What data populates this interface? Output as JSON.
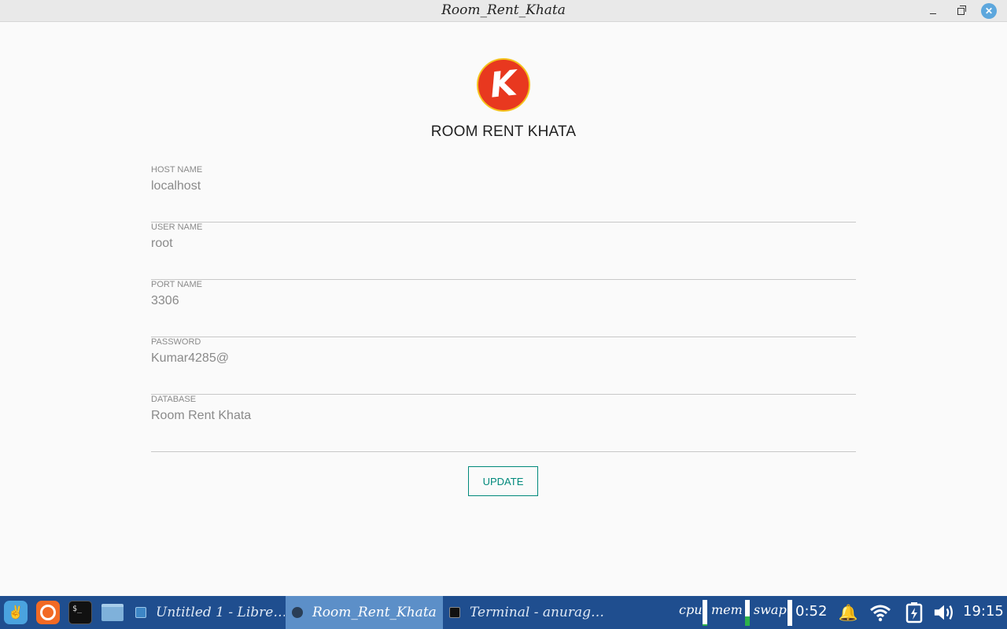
{
  "window": {
    "title": "Room_Rent_Khata"
  },
  "app": {
    "logo_letter": "K",
    "title": "ROOM RENT KHATA",
    "fields": [
      {
        "label": "HOST NAME",
        "value": "localhost"
      },
      {
        "label": "USER NAME",
        "value": "root"
      },
      {
        "label": "PORT NAME",
        "value": "3306"
      },
      {
        "label": "PASSWORD",
        "value": "Kumar4285@"
      },
      {
        "label": "DATABASE",
        "value": "Room Rent Khata"
      }
    ],
    "update_label": "UPDATE",
    "accent_color": "#00897b",
    "logo_color": "#e8381f"
  },
  "taskbar": {
    "tasks": [
      {
        "label": "Untitled 1 - Libre…"
      },
      {
        "label": "Room_Rent_Khata"
      },
      {
        "label": "Terminal - anurag…"
      }
    ],
    "monitors": {
      "cpu": "cpu",
      "mem": "mem",
      "swap": "swap",
      "mem_level": 0.35
    },
    "small_clock": "0:52",
    "clock": "19:15",
    "terminal_glyph": "$_"
  }
}
